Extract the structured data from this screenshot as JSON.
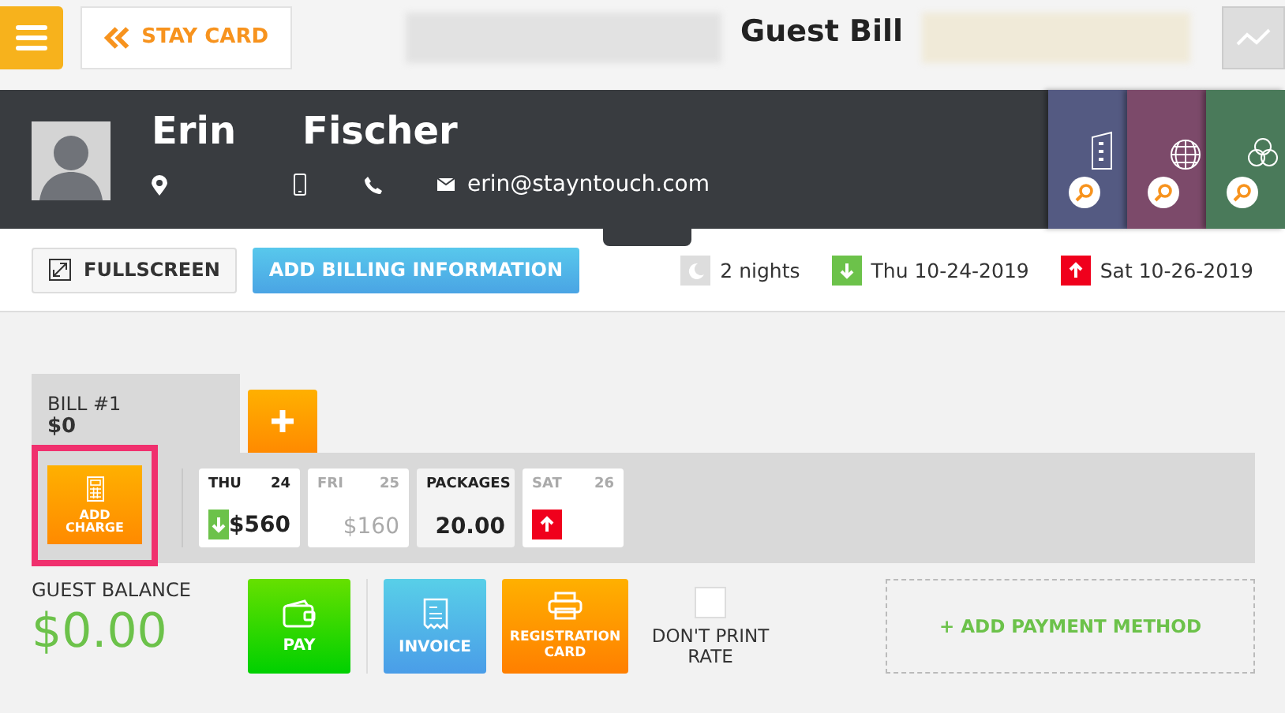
{
  "header": {
    "back_label": "STAY CARD",
    "title": "Guest Bill"
  },
  "guest": {
    "first_name": "Erin",
    "last_name": "Fischer",
    "email": "erin@stayntouch.com"
  },
  "side_cards": [
    {
      "color": "#545a82"
    },
    {
      "color": "#7c4a6a"
    },
    {
      "color": "#4a7a5a"
    }
  ],
  "toolbar": {
    "fullscreen": "FULLSCREEN",
    "billing": "ADD BILLING INFORMATION",
    "nights": "2 nights",
    "arrival": "Thu 10-24-2019",
    "departure": "Sat 10-26-2019"
  },
  "bills": [
    {
      "label": "BILL #1",
      "amount": "$0",
      "selected": true
    }
  ],
  "add_charge": {
    "label": "ADD CHARGE",
    "highlighted": true
  },
  "days": [
    {
      "kind": "day",
      "day": "THU",
      "date": "24",
      "amount": "$560",
      "arrival": true,
      "departure": false,
      "dimmed": false
    },
    {
      "kind": "day",
      "day": "FRI",
      "date": "25",
      "amount": "$160",
      "arrival": false,
      "departure": false,
      "dimmed": true
    },
    {
      "kind": "packages",
      "day": "PACKAGES",
      "amount": "20.00",
      "arrival": false,
      "departure": false,
      "dimmed": false
    },
    {
      "kind": "day",
      "day": "SAT",
      "date": "26",
      "arrival": false,
      "departure": true,
      "dimmed": true
    }
  ],
  "balance": {
    "label": "GUEST BALANCE",
    "amount": "$0.00"
  },
  "actions": [
    {
      "kind": "pay",
      "label": "PAY"
    },
    {
      "kind": "invoice",
      "label": "INVOICE"
    },
    {
      "kind": "registration",
      "label": "REGISTRATION CARD"
    }
  ],
  "dont_print": {
    "label": "DON'T PRINT RATE",
    "checked": false
  },
  "add_payment": "+ ADD PAYMENT METHOD"
}
